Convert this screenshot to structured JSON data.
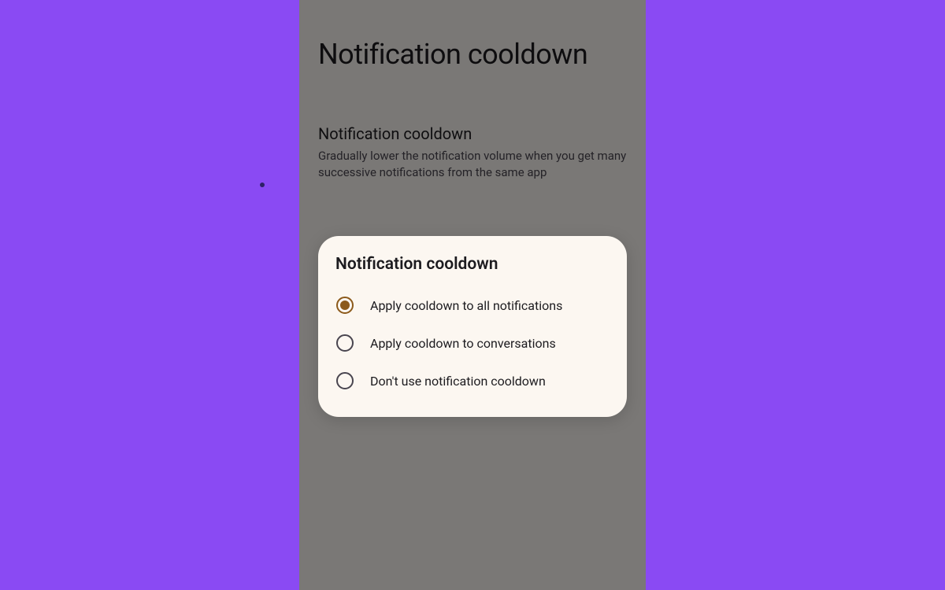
{
  "page": {
    "title": "Notification cooldown",
    "section_heading": "Notification cooldown",
    "section_description": "Gradually lower the notification volume when you get many successive notifications from the same app"
  },
  "dialog": {
    "title": "Notification cooldown",
    "options": [
      {
        "label": "Apply cooldown to all notifications",
        "selected": true
      },
      {
        "label": "Apply cooldown to conversations",
        "selected": false
      },
      {
        "label": "Don't use notification cooldown",
        "selected": false
      }
    ]
  },
  "colors": {
    "background": "#8a4af3",
    "accent": "#8c5a1b"
  }
}
